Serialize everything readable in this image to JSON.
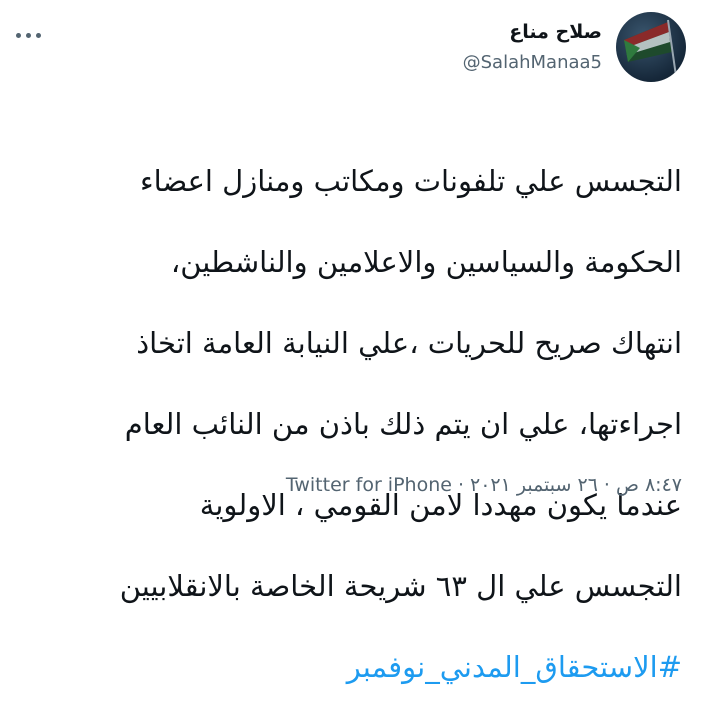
{
  "user": {
    "display_name": "صلاح مناع",
    "handle": "@SalahManaa5",
    "avatar_icon": "profile-avatar-flag"
  },
  "menu": {
    "icon": "more-options-icon"
  },
  "tweet": {
    "lines": [
      "التجسس علي تلفونات  ومكاتب ومنازل اعضاء",
      "الحكومة والسياسين والاعلامين والناشطين،",
      "انتهاك صريح للحريات ،علي النيابة العامة اتخاذ",
      "اجراءتها، علي ان يتم ذلك باذن من النائب العام",
      "عندما يكون مهددا لامن القومي ، الاولوية",
      "التجسس علي ال ٦٣ شريحة الخاصة بالانقلابيين"
    ],
    "hashtag": "#الاستحقاق_المدني_نوفمبر"
  },
  "meta": {
    "time": "٨:٤٧ ص",
    "separator": "·",
    "date": "٢٦ سبتمبر ٢٠٢١",
    "source": "Twitter for iPhone"
  },
  "colors": {
    "link": "#1d9bf0",
    "muted": "#536471",
    "text": "#0f1419"
  }
}
